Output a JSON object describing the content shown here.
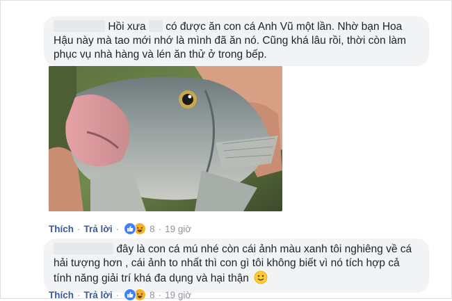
{
  "comment1": {
    "text_a": "Hồi xưa",
    "text_b": "có được ăn con cá Anh Vũ một lần. Nhờ bạn Hoa Hậu này mà tao mới nhớ là mình đã ăn nó. Cũng khá lâu rồi, thời còn làm phục vụ nhà hàng và lén ăn thử ở trong bếp.",
    "actions": {
      "like": "Thích",
      "reply": "Trả lời",
      "count": "8",
      "time": "19 giờ"
    }
  },
  "comment2": {
    "text": "đây là con cá mú nhé còn cái ảnh màu xanh tôi nghiêng về cá hải tượng hơn , cái ảnh to nhất thì con gì tôi không biết vì nó tích hợp cả tính năng giải trí khá đa dụng và hại thận",
    "actions": {
      "like": "Thích",
      "reply": "Trả lời",
      "count": "8",
      "time": "19 giờ"
    }
  },
  "icons": {
    "like": "thumbs-up-icon",
    "haha": "haha-emoji-icon",
    "smile": "smile-emoji-icon"
  },
  "colors": {
    "link": "#385898",
    "bubble": "#f2f3f5",
    "muted": "#90949c",
    "like": "#4080ff",
    "haha": "#f7b125"
  }
}
